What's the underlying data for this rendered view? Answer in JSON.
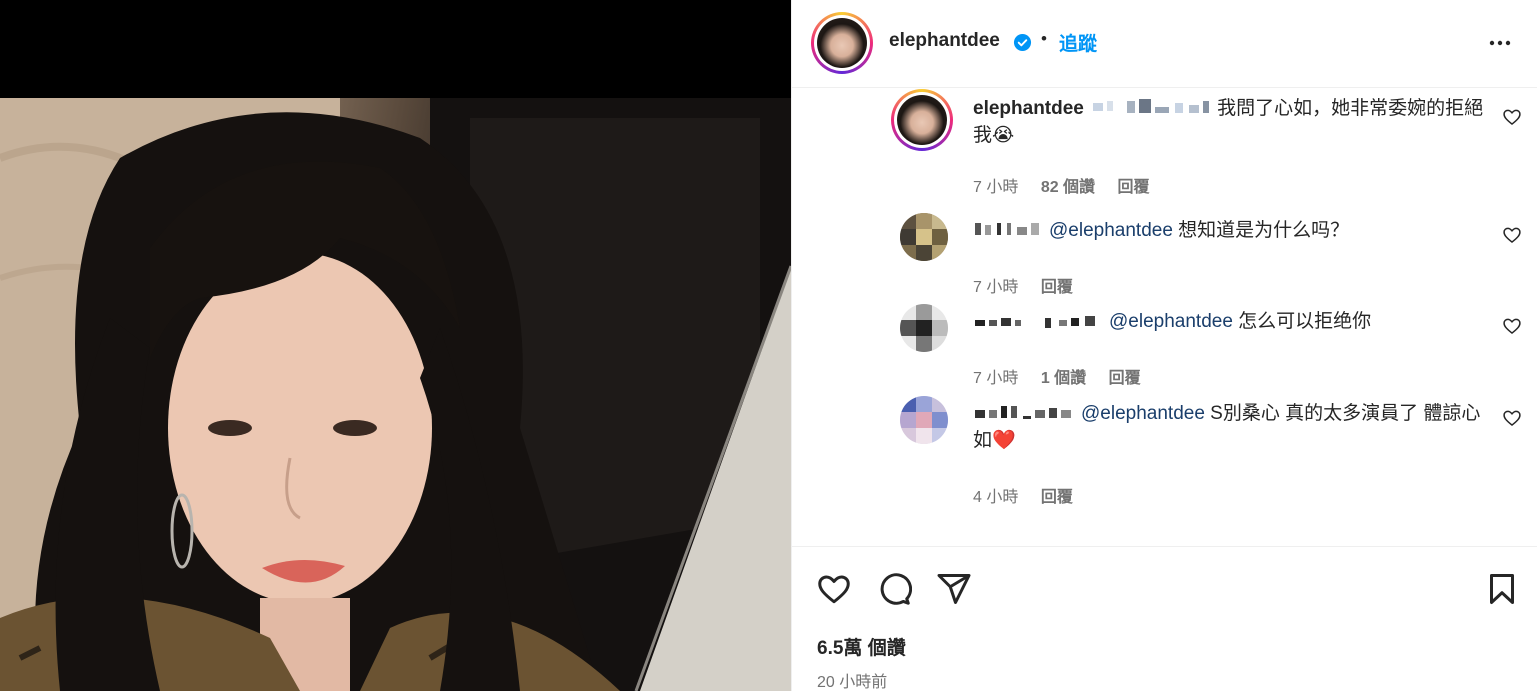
{
  "post": {
    "author": "elephantdee",
    "follow_label": "追蹤",
    "dot": "•",
    "likes": "6.5萬 個讚",
    "time": "20 小時前"
  },
  "comments": [
    {
      "name": "elephantdee",
      "text": "我問了心如，她非常委婉的拒絕我😭",
      "time": "7 小時",
      "likes": "82 個讚",
      "reply": "回覆"
    },
    {
      "mention": "@elephantdee",
      "text": " 想知道是为什么吗？",
      "time": "7 小時",
      "reply": "回覆"
    },
    {
      "mention": "@elephantdee",
      "text": " 怎么可以拒绝你",
      "time": "7 小時",
      "likes": "1 個讚",
      "reply": "回覆"
    },
    {
      "mention": "@elephantdee",
      "text": " S別桑心 真的太多演員了 體諒心如❤️",
      "time": "4 小時",
      "reply": "回覆"
    }
  ],
  "icons": {
    "verified": "verified-badge-icon",
    "more": "more-options-icon",
    "like": "heart-icon",
    "comment": "comment-icon",
    "share": "share-icon",
    "save": "bookmark-icon"
  },
  "colors": {
    "accent": "#0095f6",
    "mention": "#1a3e6b",
    "secondary_text": "#737373"
  }
}
